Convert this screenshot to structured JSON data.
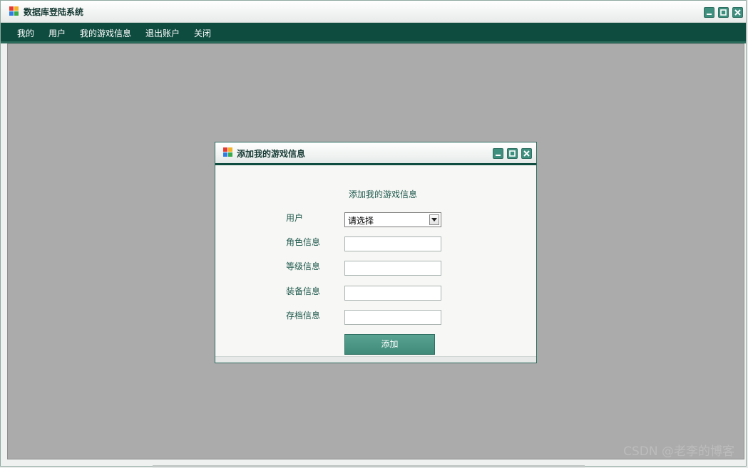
{
  "main_window": {
    "title": "数据库登陆系统"
  },
  "menu": {
    "items": [
      "我的",
      "用户",
      "我的游戏信息",
      "退出账户",
      "关闭"
    ]
  },
  "child_window": {
    "title": "添加我的游戏信息",
    "form_heading": "添加我的游戏信息",
    "fields": {
      "user_label": "用户",
      "user_selected": "请选择",
      "role_label": "角色信息",
      "level_label": "等级信息",
      "equipment_label": "装备信息",
      "save_label": "存档信息"
    },
    "add_button": "添加"
  },
  "watermark": "CSDN @老李的博客",
  "colors": {
    "menubar": "#0f4c40",
    "accent": "#3f8f7e",
    "mdi_background": "#ababab"
  }
}
